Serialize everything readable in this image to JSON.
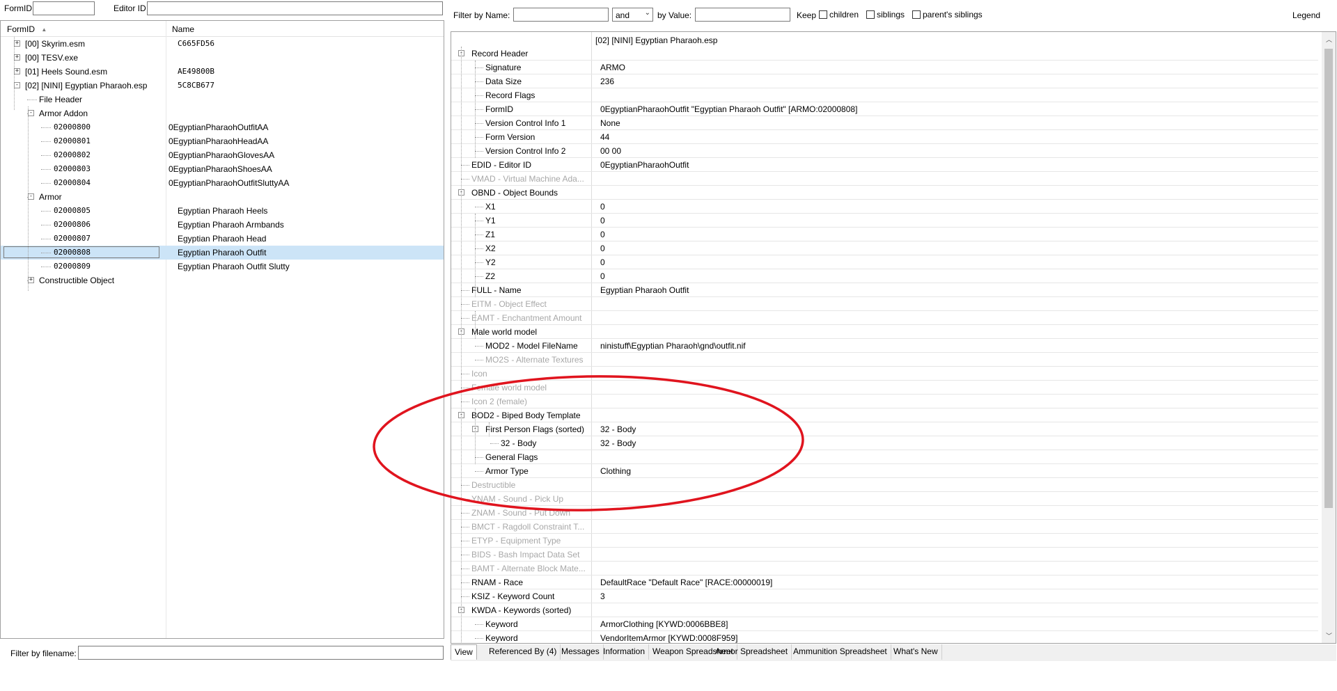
{
  "top_left": {
    "formid_label": "FormID",
    "formid_value": "",
    "editorid_label": "Editor ID",
    "editorid_value": ""
  },
  "tree": {
    "columns": [
      "FormID",
      "Name"
    ],
    "rows": [
      {
        "id": "[00] Skyrim.esm",
        "name": "C665FD56",
        "expand": "+"
      },
      {
        "id": "[00] TESV.exe",
        "name": "",
        "expand": "+"
      },
      {
        "id": "[01] Heels Sound.esm",
        "name": "AE49800B",
        "expand": "+"
      },
      {
        "id": "[02] [NINI] Egyptian Pharaoh.esp",
        "name": "5C8CB677",
        "expand": "-"
      },
      {
        "id": "File Header",
        "name": ""
      },
      {
        "id": "Armor Addon",
        "name": "",
        "expand": "-"
      },
      {
        "id": "02000800",
        "name": "0EgyptianPharaohOutfitAA"
      },
      {
        "id": "02000801",
        "name": "0EgyptianPharaohHeadAA"
      },
      {
        "id": "02000802",
        "name": "0EgyptianPharaohGlovesAA"
      },
      {
        "id": "02000803",
        "name": "0EgyptianPharaohShoesAA"
      },
      {
        "id": "02000804",
        "name": "0EgyptianPharaohOutfitSluttyAA"
      },
      {
        "id": "Armor",
        "name": "",
        "expand": "-"
      },
      {
        "id": "02000805",
        "name": "Egyptian Pharaoh Heels"
      },
      {
        "id": "02000806",
        "name": "Egyptian Pharaoh Armbands"
      },
      {
        "id": "02000807",
        "name": "Egyptian Pharaoh Head"
      },
      {
        "id": "02000808",
        "name": "Egyptian Pharaoh Outfit",
        "selected": true
      },
      {
        "id": "02000809",
        "name": "Egyptian Pharaoh Outfit Slutty"
      },
      {
        "id": "Constructible Object",
        "name": "",
        "expand": "+"
      }
    ]
  },
  "filter_filename": {
    "label": "Filter by filename:",
    "value": ""
  },
  "filter_bar": {
    "by_name_label": "Filter by Name:",
    "name_value": "",
    "operator": "and",
    "by_value_label": "by Value:",
    "value_value": "",
    "keep_label": "Keep",
    "children": "children",
    "siblings": "siblings",
    "parents_siblings": "parent's siblings",
    "legend": "Legend"
  },
  "record": {
    "file_header": "[02] [NINI] Egyptian Pharaoh.esp",
    "rows": [
      {
        "name": "Record Header",
        "value": "",
        "expand": "-"
      },
      {
        "name": "Signature",
        "value": "ARMO"
      },
      {
        "name": "Data Size",
        "value": "236"
      },
      {
        "name": "Record Flags",
        "value": ""
      },
      {
        "name": "FormID",
        "value": "0EgyptianPharaohOutfit \"Egyptian Pharaoh Outfit\" [ARMO:02000808]"
      },
      {
        "name": "Version Control Info 1",
        "value": "None"
      },
      {
        "name": "Form Version",
        "value": "44"
      },
      {
        "name": "Version Control Info 2",
        "value": "00 00"
      },
      {
        "name": "EDID - Editor ID",
        "value": "0EgyptianPharaohOutfit"
      },
      {
        "name": "VMAD - Virtual Machine Ada...",
        "value": "",
        "greyed": true
      },
      {
        "name": "OBND - Object Bounds",
        "value": "",
        "expand": "-"
      },
      {
        "name": "X1",
        "value": "0"
      },
      {
        "name": "Y1",
        "value": "0"
      },
      {
        "name": "Z1",
        "value": "0"
      },
      {
        "name": "X2",
        "value": "0"
      },
      {
        "name": "Y2",
        "value": "0"
      },
      {
        "name": "Z2",
        "value": "0"
      },
      {
        "name": "FULL - Name",
        "value": "Egyptian Pharaoh Outfit"
      },
      {
        "name": "EITM - Object Effect",
        "value": "",
        "greyed": true
      },
      {
        "name": "EAMT - Enchantment Amount",
        "value": "",
        "greyed": true
      },
      {
        "name": "Male world model",
        "value": "",
        "expand": "-"
      },
      {
        "name": "MOD2 - Model FileName",
        "value": "ninistuff\\Egyptian Pharaoh\\gnd\\outfit.nif"
      },
      {
        "name": "MO2S - Alternate Textures",
        "value": "",
        "greyed": true
      },
      {
        "name": "Icon",
        "value": "",
        "greyed": true
      },
      {
        "name": "Female world model",
        "value": "",
        "greyed": true
      },
      {
        "name": "Icon 2 (female)",
        "value": "",
        "greyed": true
      },
      {
        "name": "BOD2 - Biped Body Template",
        "value": "",
        "expand": "-"
      },
      {
        "name": "First Person Flags (sorted)",
        "value": "32 - Body",
        "expand": "-"
      },
      {
        "name": "32 - Body",
        "value": "32 - Body"
      },
      {
        "name": "General Flags",
        "value": ""
      },
      {
        "name": "Armor Type",
        "value": "Clothing"
      },
      {
        "name": "Destructible",
        "value": "",
        "greyed": true
      },
      {
        "name": "YNAM - Sound - Pick Up",
        "value": "",
        "greyed": true
      },
      {
        "name": "ZNAM - Sound - Put Down",
        "value": "",
        "greyed": true
      },
      {
        "name": "BMCT - Ragdoll Constraint T...",
        "value": "",
        "greyed": true
      },
      {
        "name": "ETYP - Equipment Type",
        "value": "",
        "greyed": true
      },
      {
        "name": "BIDS - Bash Impact Data Set",
        "value": "",
        "greyed": true
      },
      {
        "name": "BAMT - Alternate Block Mate...",
        "value": "",
        "greyed": true
      },
      {
        "name": "RNAM - Race",
        "value": "DefaultRace \"Default Race\" [RACE:00000019]"
      },
      {
        "name": "KSIZ - Keyword Count",
        "value": "3"
      },
      {
        "name": "KWDA - Keywords (sorted)",
        "value": "",
        "expand": "-"
      },
      {
        "name": "Keyword",
        "value": "ArmorClothing [KYWD:0006BBE8]"
      },
      {
        "name": "Keyword",
        "value": "VendorItemArmor [KYWD:0008F959]"
      }
    ]
  },
  "tabs": [
    "View",
    "Referenced By (4)",
    "Messages",
    "Information",
    "Weapon Spreadsheet",
    "Armor Spreadsheet",
    "Ammunition Spreadsheet",
    "What's New"
  ],
  "colors": {
    "selection": "#cce4f7",
    "annotation": "#e0141e",
    "greyed_text": "#a8a8a8"
  }
}
